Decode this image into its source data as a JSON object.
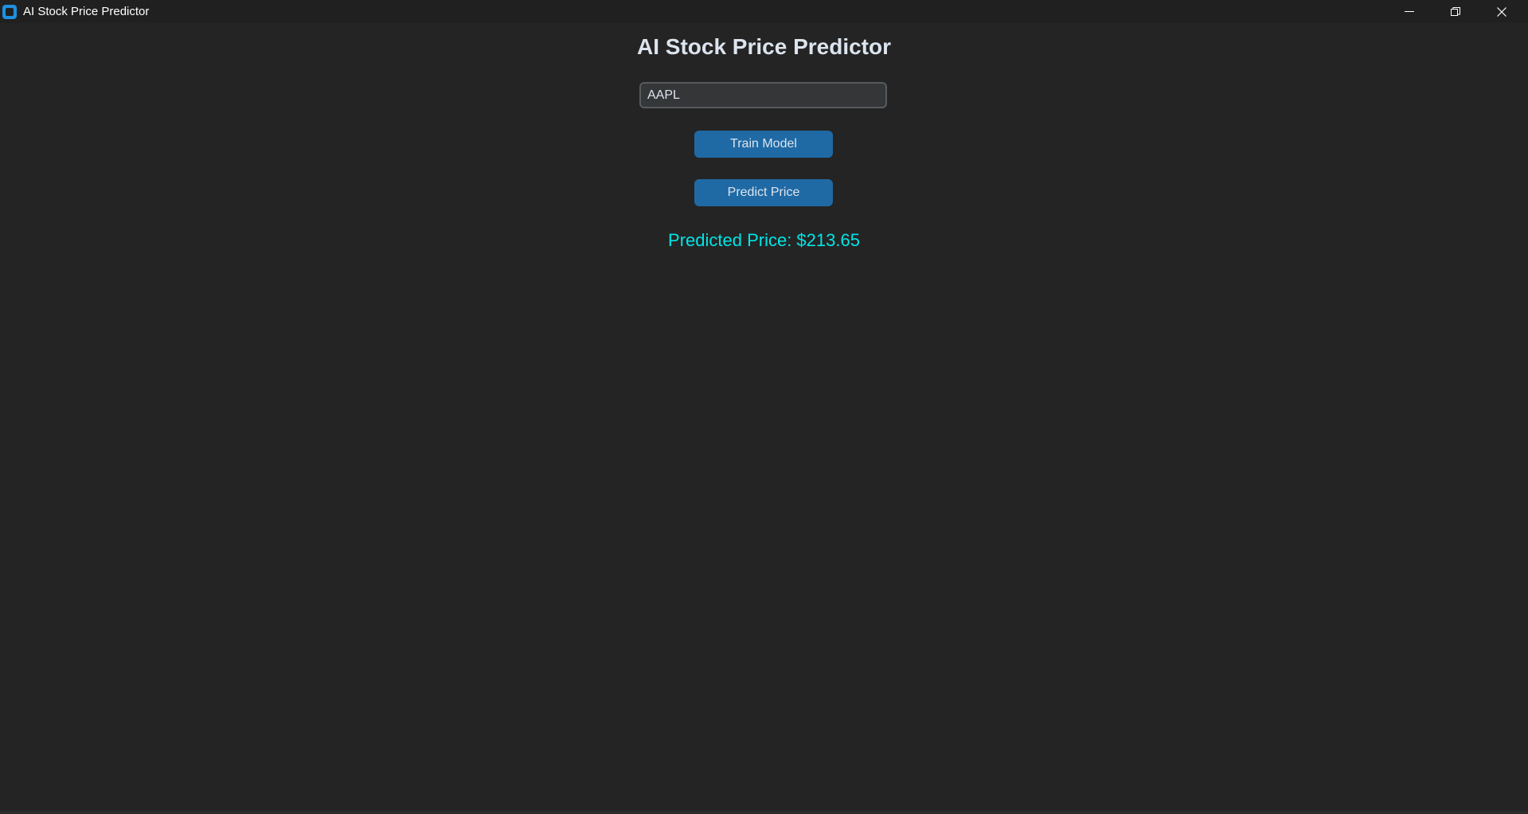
{
  "window": {
    "title": "AI Stock Price Predictor",
    "icon": "app-icon",
    "controls": [
      "minimize-icon",
      "restore-icon",
      "close-icon"
    ]
  },
  "main": {
    "heading": "AI Stock Price Predictor",
    "ticker_input": {
      "value": "AAPL",
      "placeholder": ""
    },
    "train_button_label": "Train Model",
    "predict_button_label": "Predict Price",
    "result_text": "Predicted Price: $213.65"
  },
  "colors": {
    "background": "#242424",
    "titlebar": "#202020",
    "button": "#1f6aa5",
    "result_text": "#00e5e5",
    "heading_text": "#dce4ee"
  }
}
